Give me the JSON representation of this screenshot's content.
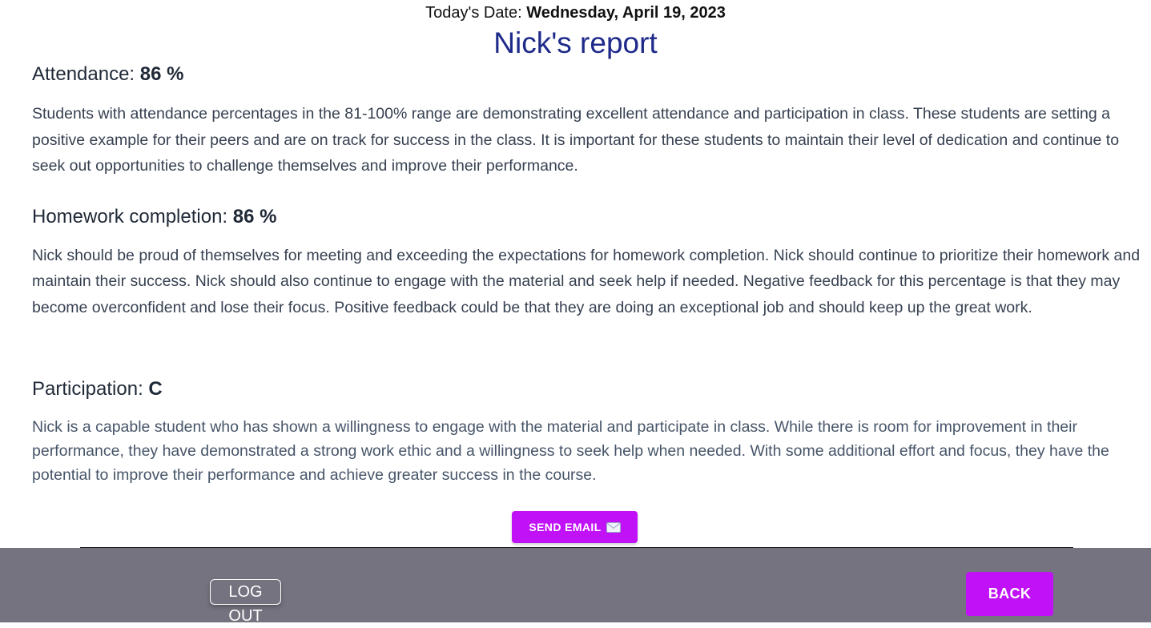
{
  "header": {
    "date_label": "Today's Date:",
    "date_value": "Wednesday, April 19, 2023",
    "title": "Nick's report"
  },
  "sections": [
    {
      "label": "Attendance:",
      "value": "86 %",
      "body": "Students with attendance percentages in the 81-100% range are demonstrating excellent attendance and participation in class. These students are setting a positive example for their peers and are on track for success in the class. It is important for these students to maintain their level of dedication and continue to seek out opportunities to challenge themselves and improve their performance."
    },
    {
      "label": "Homework completion:",
      "value": "86 %",
      "body": "Nick should be proud of themselves for meeting and exceeding the expectations for homework completion. Nick should continue to prioritize their homework and maintain their success. Nick should also continue to engage with the material and seek help if needed. Negative feedback for this percentage is that they may become overconfident and lose their focus. Positive feedback could be that they are doing an exceptional job and should keep up the great work."
    },
    {
      "label": "Participation:",
      "value": "C",
      "body": "Nick is a capable student who has shown a willingness to engage with the material and participate in class. While there is room for improvement in their performance, they have demonstrated a strong work ethic and a willingness to seek help when needed. With some additional effort and focus, they have the potential to improve their performance and achieve greater success in the course."
    }
  ],
  "actions": {
    "send_email_label": "SEND EMAIL",
    "send_email_icon": "envelope-icon"
  },
  "footer": {
    "logout_label": "LOG OUT",
    "back_label": "BACK"
  },
  "colors": {
    "title": "#1e2a8a",
    "accent": "#c111f7",
    "footer_bg": "#75737f"
  }
}
